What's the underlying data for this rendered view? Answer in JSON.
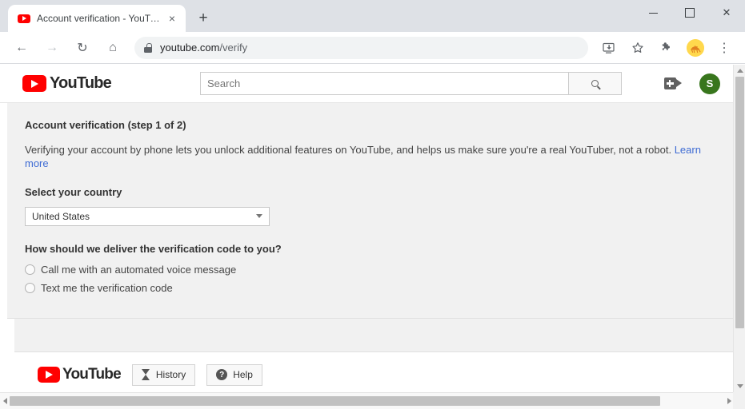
{
  "browser": {
    "tab": {
      "title": "Account verification - YouTube",
      "favicon": "youtube-favicon",
      "close_label": "×"
    },
    "new_tab_label": "+",
    "window_controls": {
      "minimize": "",
      "maximize": "",
      "close": "✕"
    },
    "nav": {
      "back": "←",
      "forward": "→",
      "reload": "↻",
      "home": "⌂"
    },
    "omnibox": {
      "domain": "youtube.com",
      "path": "/verify",
      "lock_icon": "lock-icon"
    },
    "toolbar_icons": {
      "install": "⤓",
      "bookmark": "☆",
      "extensions": "❖",
      "profile": "🐕",
      "menu": "⋮"
    }
  },
  "youtube_header": {
    "logo_text": "YouTube",
    "search_placeholder": "Search",
    "search_value": "",
    "search_button_icon": "search-icon",
    "create_icon": "video-camera-plus-icon",
    "avatar_initial": "S"
  },
  "main": {
    "heading": "Account verification (step 1 of 2)",
    "intro_text": "Verifying your account by phone lets you unlock additional features on YouTube, and helps us make sure you're a real YouTuber, not a robot.",
    "learn_more": "Learn more",
    "country_label": "Select your country",
    "country_selected": "United States",
    "delivery_label": "How should we deliver the verification code to you?",
    "delivery_options": [
      {
        "label": "Call me with an automated voice message",
        "selected": false
      },
      {
        "label": "Text me the verification code",
        "selected": false
      }
    ]
  },
  "footer": {
    "logo_text": "YouTube",
    "history_label": "History",
    "history_icon": "hourglass-icon",
    "help_label": "Help",
    "help_icon": "question-mark-icon"
  },
  "colors": {
    "youtube_red": "#ff0000",
    "link_blue": "#3f6cd4",
    "avatar_green": "#38761d",
    "panel_bg": "#f1f1f1",
    "chrome_bg": "#dee1e6"
  }
}
